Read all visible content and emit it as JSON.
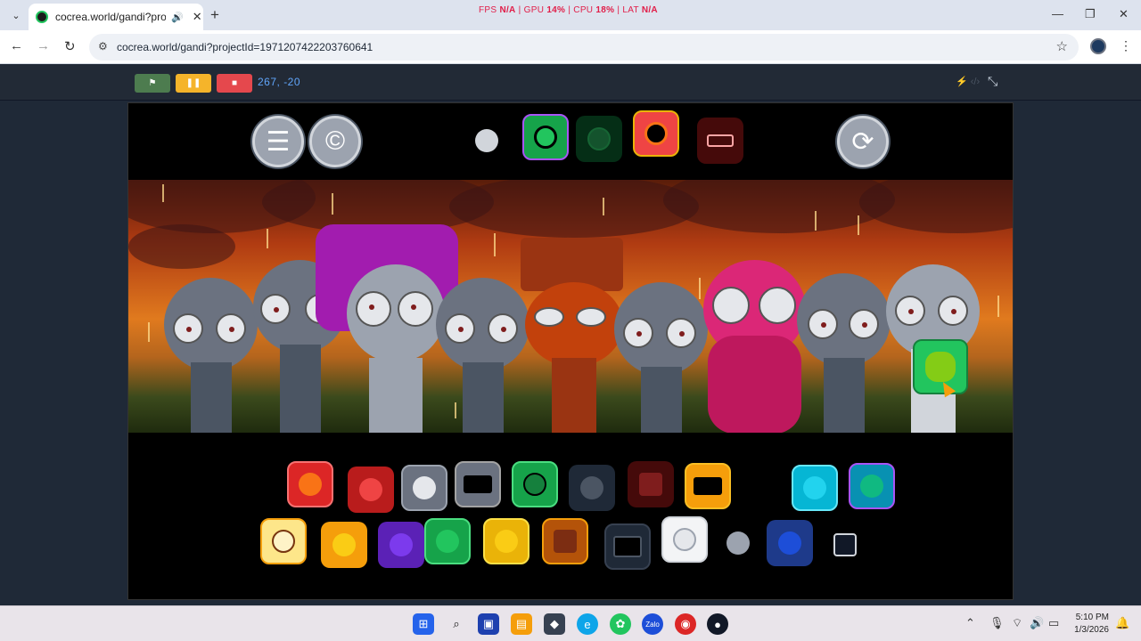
{
  "browser": {
    "tab_title": "cocrea.world/gandi?project",
    "url": "cocrea.world/gandi?projectId=1971207422203760641",
    "perf": {
      "fps_label": "FPS",
      "fps_value": "N/A",
      "gpu_label": "GPU",
      "gpu_value": "14%",
      "cpu_label": "CPU",
      "cpu_value": "18%",
      "lat_label": "LAT",
      "lat_value": "N/A"
    }
  },
  "editor": {
    "coords": "267, -20",
    "green_flag": "⚑",
    "pause": "❚❚",
    "stop": "■"
  },
  "stage": {
    "menu_icon": "☰",
    "copyright_icon": "©",
    "reset_icon": "⟳",
    "top_icons": [
      {
        "name": "gray-bug",
        "color": "#9ca3af"
      },
      {
        "name": "green-cat",
        "color": "#22c55e"
      },
      {
        "name": "dark-cat",
        "color": "#14532d"
      },
      {
        "name": "red-demon",
        "color": "#ef4444"
      },
      {
        "name": "red-bench",
        "color": "#7f1d1d"
      }
    ],
    "row1_icons": [
      {
        "name": "red-clock",
        "color": "#dc2626"
      },
      {
        "name": "red-sun",
        "color": "#b91c1c"
      },
      {
        "name": "gray-bowl",
        "color": "#9ca3af"
      },
      {
        "name": "gray-tv",
        "color": "#6b7280"
      },
      {
        "name": "green-flower",
        "color": "#16a34a"
      },
      {
        "name": "dark-gray-blob",
        "color": "#374151"
      },
      {
        "name": "dark-red-cup",
        "color": "#450a0a"
      },
      {
        "name": "orange-tv",
        "color": "#f59e0b"
      },
      {
        "name": "teal-teddy",
        "color": "#06b6d4"
      },
      {
        "name": "teal-cat",
        "color": "#0e7490"
      }
    ],
    "row2_icons": [
      {
        "name": "cream-clock",
        "color": "#fde68a"
      },
      {
        "name": "yellow-sun",
        "color": "#f59e0b"
      },
      {
        "name": "purple-devil",
        "color": "#7c3aed"
      },
      {
        "name": "green-tree",
        "color": "#16a34a"
      },
      {
        "name": "yellow-frog",
        "color": "#eab308"
      },
      {
        "name": "brown-hat",
        "color": "#b45309"
      },
      {
        "name": "black-tv",
        "color": "#1f2937"
      },
      {
        "name": "white-cat",
        "color": "#f3f4f6"
      },
      {
        "name": "gray-bunny",
        "color": "#9ca3af"
      },
      {
        "name": "blue-orb",
        "color": "#1d4ed8"
      },
      {
        "name": "black-top-hat",
        "color": "#111827"
      }
    ]
  },
  "taskbar": {
    "time": "5:10 PM",
    "date": "1/3/2026"
  }
}
